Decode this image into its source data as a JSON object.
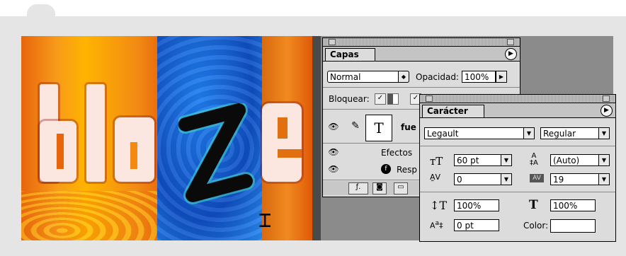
{
  "canvas": {
    "letters": [
      "b",
      "l",
      "a",
      "z",
      "e"
    ]
  },
  "layers_panel": {
    "tab": "Capas",
    "blend_mode": "Normal",
    "opacity_label": "Opacidad:",
    "opacity_value": "100%",
    "lock_label": "Bloquear:",
    "layer_type_glyph": "T",
    "layer_name": "fue",
    "effects_label": "Efectos",
    "effect_item": "Resp"
  },
  "character_panel": {
    "tab": "Carácter",
    "font_family": "Legault",
    "font_style": "Regular",
    "font_size": "60 pt",
    "leading": "(Auto)",
    "kerning": "0",
    "tracking": "19",
    "vertical_scale": "100%",
    "horizontal_scale": "100%",
    "baseline_shift": "0 pt",
    "color_label": "Color:"
  }
}
